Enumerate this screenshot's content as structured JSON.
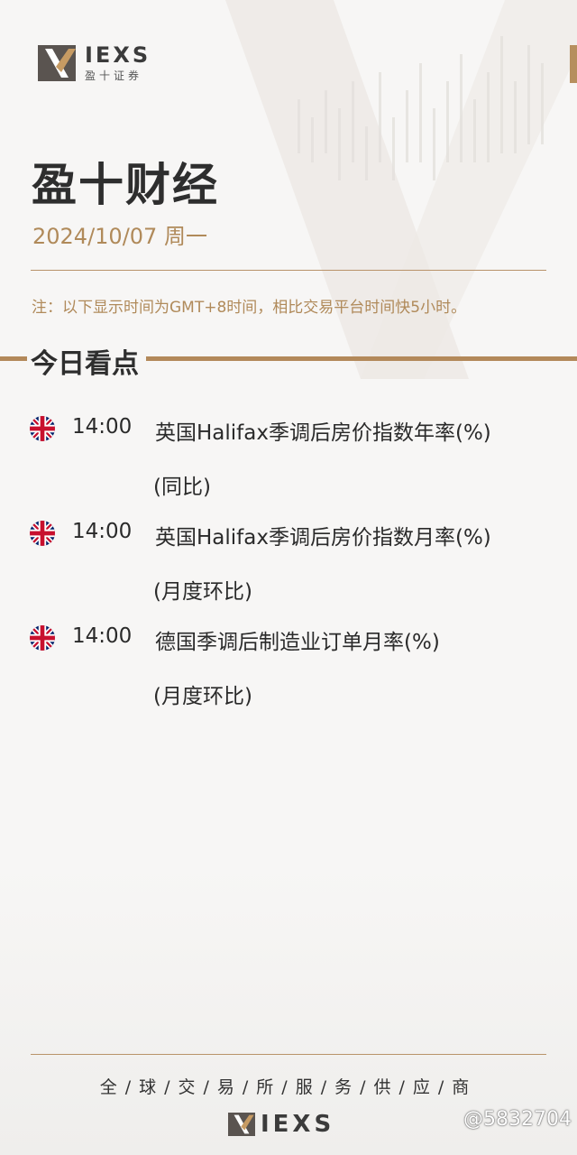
{
  "brand": {
    "logo_en": "IEXS",
    "logo_cn": "盈十证券"
  },
  "header": {
    "title": "盈十财经",
    "date": "2024/10/07  周一",
    "note": "注：以下显示时间为GMT+8时间，相比交易平台时间快5小时。"
  },
  "section": {
    "title": "今日看点"
  },
  "events": [
    {
      "flag": "uk-flag-icon",
      "time": "14:00",
      "title": "英国Halifax季调后房价指数年率(%)",
      "subtitle": "(同比)"
    },
    {
      "flag": "uk-flag-icon",
      "time": "14:00",
      "title": "英国Halifax季调后房价指数月率(%)",
      "subtitle": "(月度环比)"
    },
    {
      "flag": "uk-flag-icon",
      "time": "14:00",
      "title": "德国季调后制造业订单月率(%)",
      "subtitle": "(月度环比)"
    }
  ],
  "footer": {
    "slogan": "全/球/交/易/所/服/务/供/应/商",
    "logo_text": "IEXS",
    "watermark": "@5832704"
  },
  "colors": {
    "accent": "#b08a5a",
    "text": "#2a2a2a"
  }
}
